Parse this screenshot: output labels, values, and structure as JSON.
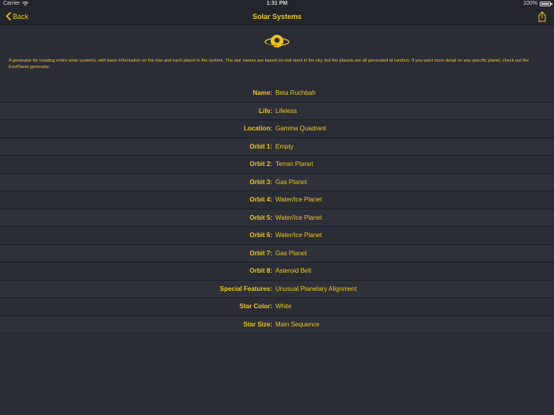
{
  "status": {
    "carrier": "Carrier",
    "time": "1:31 PM",
    "battery": "100%"
  },
  "nav": {
    "back_label": "Back",
    "title": "Solar Systems"
  },
  "description": "A generator for creating entire solar systems, with basic information on the star and each planet in the system. The star names are based on real stars in the sky, but the planets are all generated at random. If you want more detail on any specific planet, check out the ExoPlanet generator.",
  "results": [
    {
      "label": "Name:",
      "value": "Beta Ruchbah"
    },
    {
      "label": "Life:",
      "value": "Lifeless"
    },
    {
      "label": "Location:",
      "value": "Gamma Quadrant"
    },
    {
      "label": "Orbit 1:",
      "value": "Empty"
    },
    {
      "label": "Orbit 2:",
      "value": "Terran Planet"
    },
    {
      "label": "Orbit 3:",
      "value": "Gas Planet"
    },
    {
      "label": "Orbit 4:",
      "value": "Water/Ice Planet"
    },
    {
      "label": "Orbit 5:",
      "value": "Water/Ice Planet"
    },
    {
      "label": "Orbit 6:",
      "value": "Water/Ice Planet"
    },
    {
      "label": "Orbit 7:",
      "value": "Gas Planet"
    },
    {
      "label": "Orbit 8:",
      "value": "Asteroid Belt"
    },
    {
      "label": "Special Features:",
      "value": "Unusual Planetary Alignment"
    },
    {
      "label": "Star Color:",
      "value": "White"
    },
    {
      "label": "Star Size:",
      "value": "Main Sequence"
    }
  ],
  "icons": {
    "back": "chevron-left-icon",
    "share": "share-icon",
    "hero": "solar-system-icon",
    "wifi": "wifi-icon"
  },
  "colors": {
    "accent": "#f2c31a",
    "background": "#2a2d35",
    "bar": "#22252b"
  }
}
